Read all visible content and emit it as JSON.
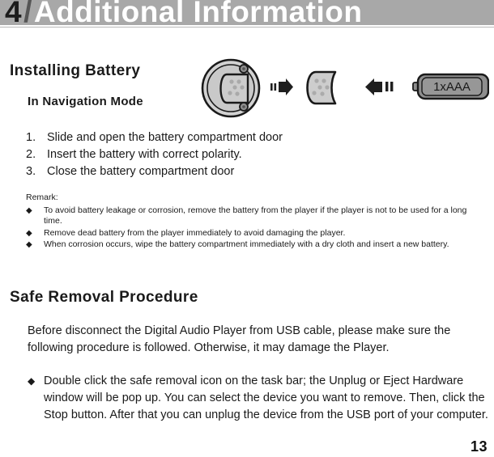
{
  "header": {
    "chapter": "4",
    "separator": "/",
    "title": "Additional Information"
  },
  "sections": {
    "installing_battery_heading": "Installing Battery",
    "navigation_mode_heading": "In Navigation Mode",
    "safe_removal_heading": "Safe Removal Procedure"
  },
  "diagram": {
    "battery_label": "1xAAA",
    "arrow_right_icon": "arrow-right-icon",
    "arrow_left_icon": "arrow-left-icon",
    "player_body_icon": "player-back-cover-icon",
    "battery_door_icon": "battery-door-icon",
    "battery_icon": "aaa-battery-icon"
  },
  "steps": [
    {
      "num": "1.",
      "text": "Slide and open the battery compartment door"
    },
    {
      "num": "2.",
      "text": "Insert the battery with correct polarity."
    },
    {
      "num": "3.",
      "text": "Close the battery compartment door"
    }
  ],
  "remark": {
    "label": "Remark:",
    "bullet_glyph": "◆",
    "items": [
      "To avoid battery leakage or corrosion, remove the battery from the player if the player is not to be used for a long time.",
      "Remove dead battery from the player immediately to avoid damaging the player.",
      "When corrosion occurs, wipe the battery compartment immediately with a dry cloth and insert a new battery."
    ]
  },
  "safe_removal": {
    "paragraph": "Before disconnect the Digital Audio Player from USB cable, please make sure the following procedure is followed.  Otherwise, it may damage the Player.",
    "bullet_glyph": "◆",
    "items": [
      "Double click the  safe removal  icon on the task bar; the  Unplug or Eject Hardware  window will be pop up. You can select the device you want to remove. Then, click the  Stop  button. After that you can unplug the device from the USB port of your computer."
    ]
  },
  "footer": {
    "page_number": "13"
  },
  "colors": {
    "header_bar": "#a8a8a8",
    "header_title": "#ffffff",
    "header_chapter": "#1c1c1c",
    "body_text": "#1a1a1a",
    "diagram_fill_light": "#d0d0d0",
    "diagram_fill_mid": "#8f8f8f",
    "diagram_outline": "#1a1a1a"
  }
}
